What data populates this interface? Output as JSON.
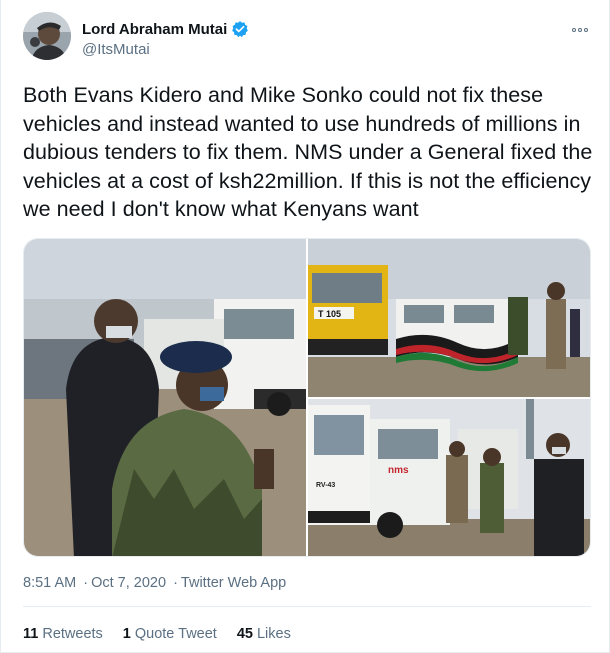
{
  "author": {
    "name": "Lord Abraham Mutai",
    "handle": "@ItsMutai",
    "verified": true
  },
  "icons": {
    "verified": "verified-badge-icon",
    "more": "more-options-icon"
  },
  "tweet": {
    "text": "Both Evans Kidero and Mike Sonko could not fix these vehicles and instead wanted to use hundreds of millions in dubious tenders to fix them. NMS under a General fixed the vehicles at a cost of ksh22million. If this is not the efficiency we need I don't know what Kenyans want"
  },
  "media": {
    "photo2_plate": "T 105",
    "photo3_plate_a": "RV-43",
    "photo3_logo": "nms"
  },
  "meta": {
    "time": "8:51 AM",
    "separator": "·",
    "date": "Oct 7, 2020",
    "source": "Twitter Web App"
  },
  "stats": {
    "retweets_count": "11",
    "retweets_label": "Retweets",
    "quotes_count": "1",
    "quotes_label": "Quote Tweet",
    "likes_count": "45",
    "likes_label": "Likes"
  },
  "colors": {
    "accent": "#1da1f2",
    "secondary_text": "#5b7083",
    "primary_text": "#0f1419"
  }
}
